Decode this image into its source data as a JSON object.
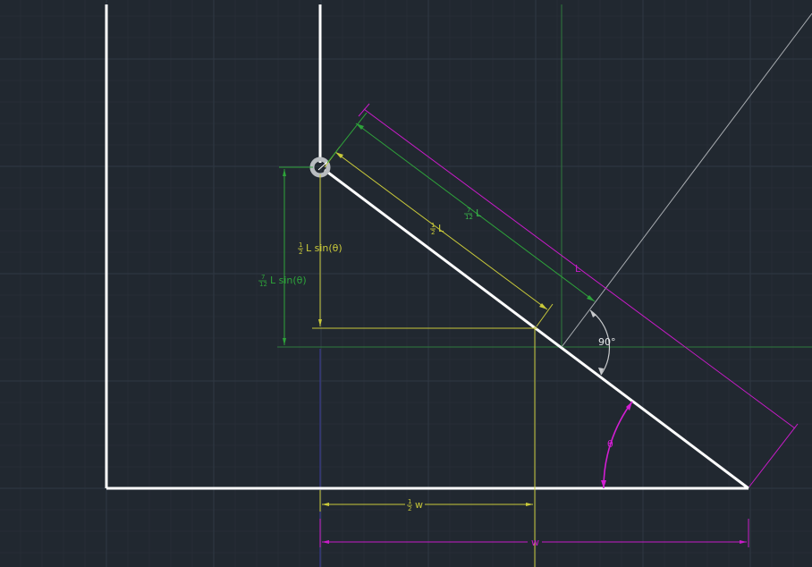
{
  "colors": {
    "background": "#212830",
    "grid_major": "#2f3843",
    "grid_minor": "#262d36",
    "structure": "#ffffff",
    "yellow": "#c9c93a",
    "green": "#2ea33a",
    "green_light": "#3ab54a",
    "magenta": "#c81bc8",
    "gray": "#a8acb0",
    "blue_axis": "#3a3a9a",
    "green_axis": "#2e7a3c"
  },
  "labels": {
    "half_L": {
      "num": "1",
      "den": "2",
      "sym": "L"
    },
    "seven_twelfths_L": {
      "num": "7",
      "den": "12",
      "sym": "L"
    },
    "L": "L",
    "half_L_sin": {
      "num": "1",
      "den": "2",
      "text": "L sin(θ)"
    },
    "seven_twelfths_L_sin": {
      "num": "7",
      "den": "12",
      "text": "L sin(θ)"
    },
    "angle_90": "90°",
    "theta": "θ",
    "half_w": {
      "num": "1",
      "den": "2",
      "sym": "w"
    },
    "w": "w"
  }
}
